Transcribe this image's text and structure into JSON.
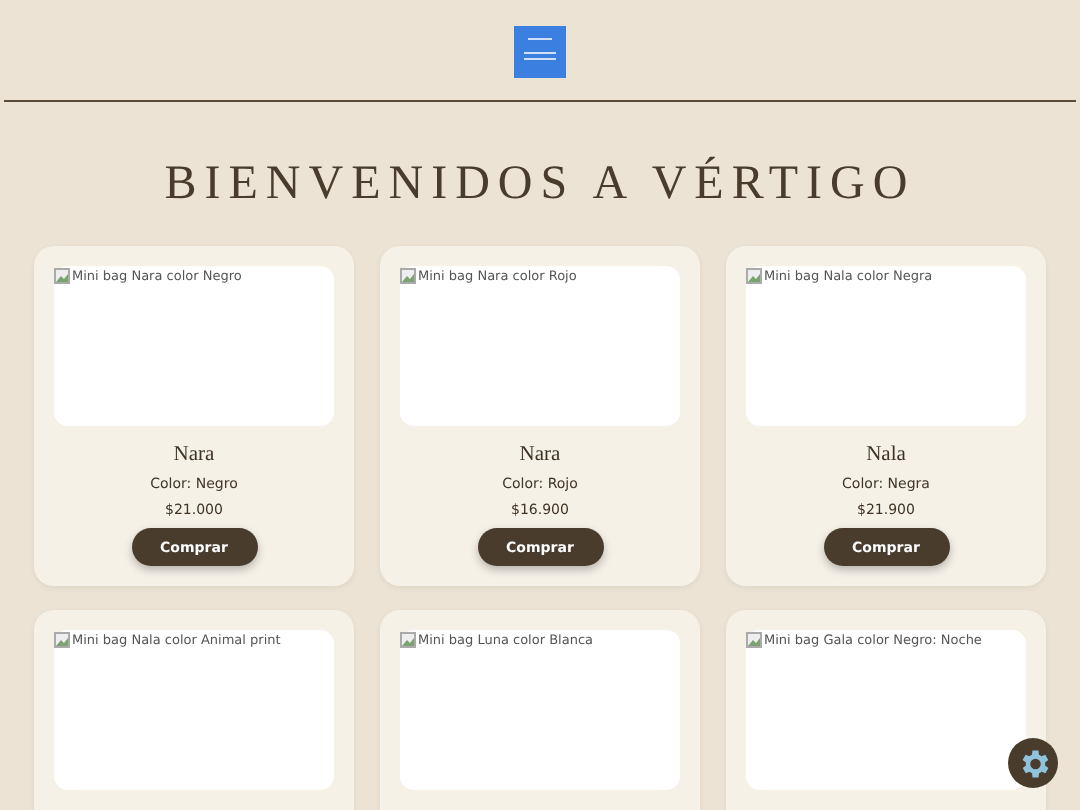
{
  "title": "BIENVENIDOS A VÉRTIGO",
  "products": [
    {
      "alt": "Mini bag Nara color Negro",
      "name": "Nara",
      "color_label": "Color: Negro",
      "price": "$21.000",
      "button": "Comprar"
    },
    {
      "alt": "Mini bag Nara color Rojo",
      "name": "Nara",
      "color_label": "Color: Rojo",
      "price": "$16.900",
      "button": "Comprar"
    },
    {
      "alt": "Mini bag Nala color Negra",
      "name": "Nala",
      "color_label": "Color: Negra",
      "price": "$21.900",
      "button": "Comprar"
    },
    {
      "alt": "Mini bag Nala color Animal print"
    },
    {
      "alt": "Mini bag Luna color Blanca"
    },
    {
      "alt": "Mini bag Gala color Negro: Noche"
    }
  ]
}
